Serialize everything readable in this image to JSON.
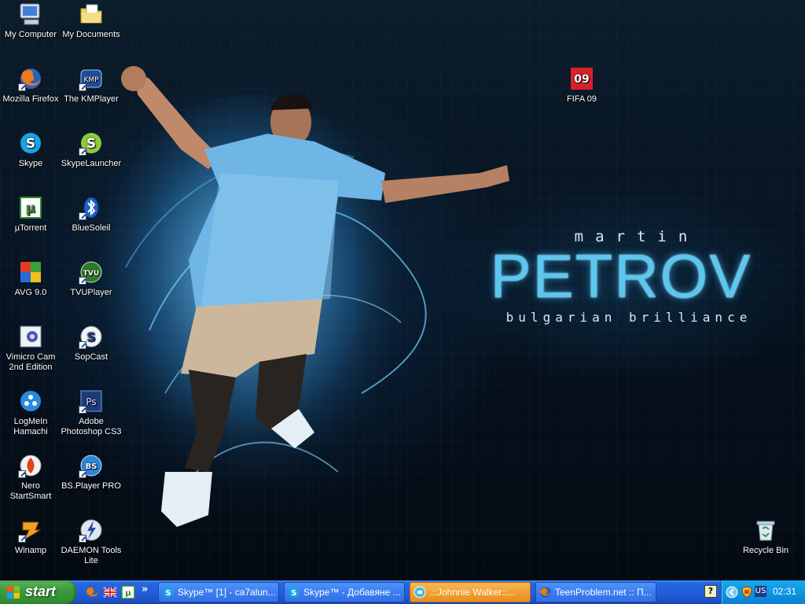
{
  "wallpaper": {
    "first_name": "martin",
    "last_name": "PETROV",
    "tagline": "bulgarian brilliance"
  },
  "desktop_icons": [
    {
      "label": "My Computer",
      "icon": "my-computer-icon"
    },
    {
      "label": "My Documents",
      "icon": "my-documents-icon"
    },
    {
      "label": "Mozilla Firefox",
      "icon": "firefox-icon"
    },
    {
      "label": "The KMPlayer",
      "icon": "kmplayer-icon"
    },
    {
      "label": "FIFA 09",
      "icon": "fifa09-icon"
    },
    {
      "label": "Skype",
      "icon": "skype-icon"
    },
    {
      "label": "SkypeLauncher",
      "icon": "skype-launcher-icon"
    },
    {
      "label": "µTorrent",
      "icon": "utorrent-icon"
    },
    {
      "label": "BlueSoleil",
      "icon": "bluetooth-icon"
    },
    {
      "label": "AVG 9.0",
      "icon": "avg-icon"
    },
    {
      "label": "TVUPlayer",
      "icon": "tvu-icon"
    },
    {
      "label": "Vimicro Cam 2nd Edition",
      "icon": "webcam-icon"
    },
    {
      "label": "SopCast",
      "icon": "sopcast-icon"
    },
    {
      "label": "LogMeIn Hamachi",
      "icon": "hamachi-icon"
    },
    {
      "label": "Adobe Photoshop CS3",
      "icon": "photoshop-icon"
    },
    {
      "label": "Nero StartSmart",
      "icon": "nero-icon"
    },
    {
      "label": "BS.Player PRO",
      "icon": "bsplayer-icon"
    },
    {
      "label": "Winamp",
      "icon": "winamp-icon"
    },
    {
      "label": "DAEMON Tools Lite",
      "icon": "daemon-tools-icon"
    },
    {
      "label": "Recycle Bin",
      "icon": "recycle-bin-icon"
    }
  ],
  "taskbar": {
    "start_label": "start",
    "tasks": [
      {
        "label": "Skype™ [1] - ca7alun...",
        "icon": "skype-icon",
        "active": false
      },
      {
        "label": "Skype™ - Добавяне ...",
        "icon": "skype-icon",
        "active": false
      },
      {
        "label": ".::Johnnie Walker::...",
        "icon": "chat-icon",
        "active": true
      },
      {
        "label": "TeenProblem.net :: П...",
        "icon": "firefox-icon",
        "active": false
      }
    ],
    "chevron": "»",
    "help": "?",
    "language": "US",
    "clock": "02:31"
  },
  "colors": {
    "taskbar_blue": "#245edb",
    "start_green": "#3c9b3c",
    "tray_blue": "#0e95e3",
    "active_task_orange": "#f2a132",
    "petrov_cyan": "#5cc6ef"
  }
}
